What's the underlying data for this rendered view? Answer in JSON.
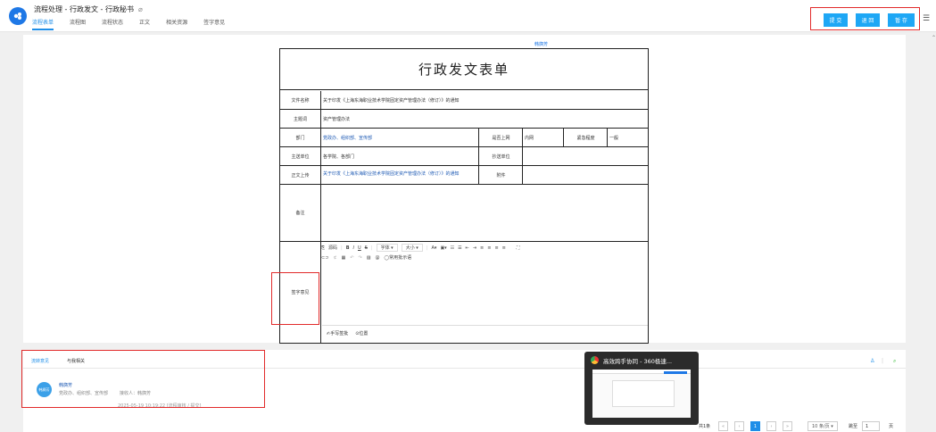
{
  "header": {
    "title": "流程处理 - 行政发文 - 行政秘书",
    "tabs": [
      "流程表单",
      "流程图",
      "流程状态",
      "正文",
      "相关资源",
      "签字意见"
    ],
    "buttons": {
      "submit": "提 交",
      "return": "退 回",
      "save": "暂 存"
    }
  },
  "form": {
    "user": "韩旖芳",
    "title": "行政发文表单",
    "rows": {
      "doc_name_label": "文件名称",
      "doc_name_value": "关于印发《上海东海职业技术学院固定资产管理办法（修订）》的通知",
      "subject_label": "主题词",
      "subject_value": "资产管理办法",
      "dept_label": "部门",
      "dept_value": "党政办、组织部、宣传部",
      "online_label": "是否上网",
      "online_value": "内网",
      "urgency_label": "紧急程度",
      "urgency_value": "一般",
      "main_send_label": "主送单位",
      "main_send_value": "各学院、各部门",
      "cc_label": "抄送单位",
      "cc_value": "",
      "body_label": "正文上传",
      "body_value": "关于印发《上海东海职业技术学院固定资产管理办法（修订）》的通知",
      "attach_label": "附件",
      "remark_label": "备注",
      "opinion_label": "签字意见"
    },
    "editor": {
      "row1": [
        "源码",
        "B",
        "I",
        "U",
        "S",
        "字体",
        "大小"
      ],
      "common": "常用批示语",
      "handwrite": "手写签批",
      "location": "位置"
    }
  },
  "bottom": {
    "tabs": [
      "流转意见",
      "与我相关"
    ],
    "entry": {
      "avatar": "韩旖芳",
      "name": "韩旖芳",
      "dept": "党政办、组织部、宣传部",
      "receiver": "接收人：韩旖芳",
      "time": "2025-05-19 10:19:22",
      "status": "[流程审核 / 提交]"
    },
    "pager": {
      "total": "共1条",
      "page": "1",
      "per_page": "10 条/页",
      "goto_label": "跳至",
      "goto_value": "1",
      "page_unit": "页"
    }
  },
  "popup": {
    "title": "高效跨手协同 - 360极速..."
  }
}
